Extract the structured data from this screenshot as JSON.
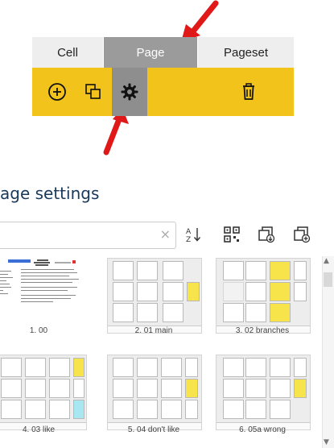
{
  "tabs": {
    "cell": "Cell",
    "page": "Page",
    "pageset": "Pageset"
  },
  "toolbar": {
    "add": "add-circle-icon",
    "copy": "copy-pages-icon",
    "settings": "gear-icon",
    "delete": "trash-icon",
    "accent": "#f2c31b"
  },
  "page_settings": {
    "title": "age settings"
  },
  "search": {
    "placeholder": ""
  },
  "thumbnails": [
    {
      "label": "1. 00"
    },
    {
      "label": "2. 01 main"
    },
    {
      "label": "3. 02 branches"
    },
    {
      "label": "4. 03 like"
    },
    {
      "label": "5. 04 don't like"
    },
    {
      "label": "6. 05a wrong"
    }
  ],
  "colors": {
    "arrow": "#e01818",
    "title": "#18395a",
    "active_tab": "#9b9b9b"
  }
}
